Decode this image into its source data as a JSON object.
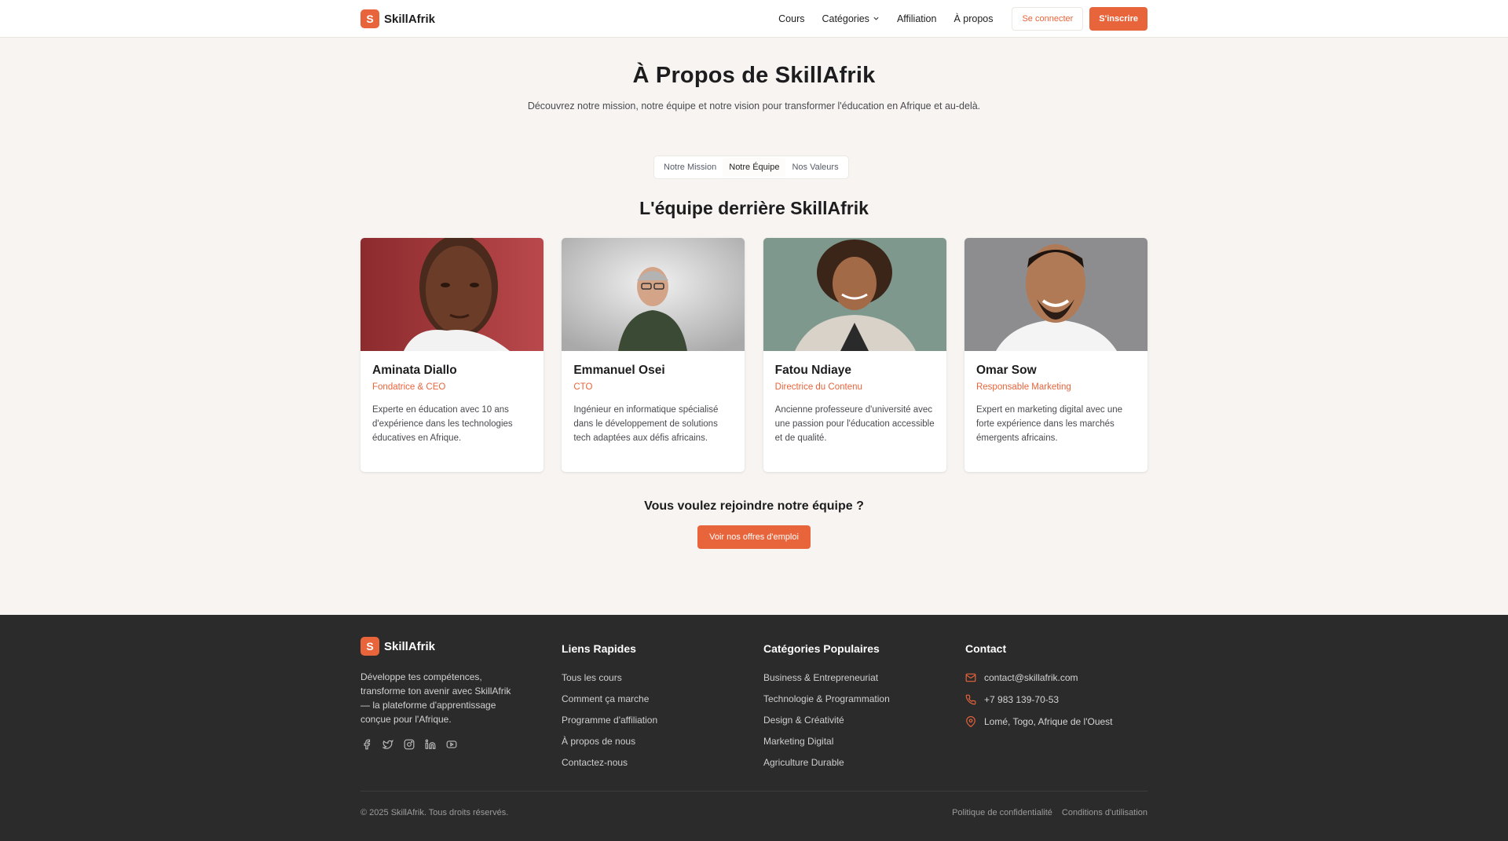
{
  "header": {
    "logo_letter": "S",
    "logo_text": "SkillAfrik",
    "nav": [
      "Cours",
      "Catégories",
      "Affiliation",
      "À propos"
    ],
    "login_label": "Se connecter",
    "signup_label": "S'inscrire"
  },
  "hero": {
    "title": "À Propos de SkillAfrik",
    "subtitle": "Découvrez notre mission, notre équipe et notre vision pour transformer l'éducation en Afrique et au-delà."
  },
  "tabs": [
    {
      "label": "Notre Mission",
      "active": false
    },
    {
      "label": "Notre Équipe",
      "active": true
    },
    {
      "label": "Nos Valeurs",
      "active": false
    }
  ],
  "team": {
    "title": "L'équipe derrière SkillAfrik",
    "members": [
      {
        "name": "Aminata Diallo",
        "role": "Fondatrice & CEO",
        "description": "Experte en éducation avec 10 ans d'expérience dans les technologies éducatives en Afrique."
      },
      {
        "name": "Emmanuel Osei",
        "role": "CTO",
        "description": "Ingénieur en informatique spécialisé dans le développement de solutions tech adaptées aux défis africains."
      },
      {
        "name": "Fatou Ndiaye",
        "role": "Directrice du Contenu",
        "description": "Ancienne professeure d'université avec une passion pour l'éducation accessible et de qualité."
      },
      {
        "name": "Omar Sow",
        "role": "Responsable Marketing",
        "description": "Expert en marketing digital avec une forte expérience dans les marchés émergents africains."
      }
    ]
  },
  "join": {
    "title": "Vous voulez rejoindre notre équipe ?",
    "button": "Voir nos offres d'emploi"
  },
  "footer": {
    "brand": {
      "logo_letter": "S",
      "name": "SkillAfrik",
      "description": "Développe tes compétences, transforme ton avenir avec SkillAfrik — la plateforme d'apprentissage conçue pour l'Afrique."
    },
    "socials": [
      "facebook-icon",
      "twitter-icon",
      "instagram-icon",
      "linkedin-icon",
      "youtube-icon"
    ],
    "quick_links": {
      "title": "Liens Rapides",
      "items": [
        "Tous les cours",
        "Comment ça marche",
        "Programme d'affiliation",
        "À propos de nous",
        "Contactez-nous"
      ]
    },
    "categories": {
      "title": "Catégories Populaires",
      "items": [
        "Business & Entrepreneuriat",
        "Technologie & Programmation",
        "Design & Créativité",
        "Marketing Digital",
        "Agriculture Durable"
      ]
    },
    "contact": {
      "title": "Contact",
      "email": "contact@skillafrik.com",
      "phone": "+7 983 139-70-53",
      "address": "Lomé, Togo, Afrique de l'Ouest"
    },
    "copyright": "© 2025 SkillAfrik. Tous droits réservés.",
    "legal": [
      "Politique de confidentialité",
      "Conditions d'utilisation"
    ]
  },
  "colors": {
    "accent": "#e8643b",
    "page_bg": "#f7f4f1",
    "footer_bg": "#2b2b2b"
  }
}
